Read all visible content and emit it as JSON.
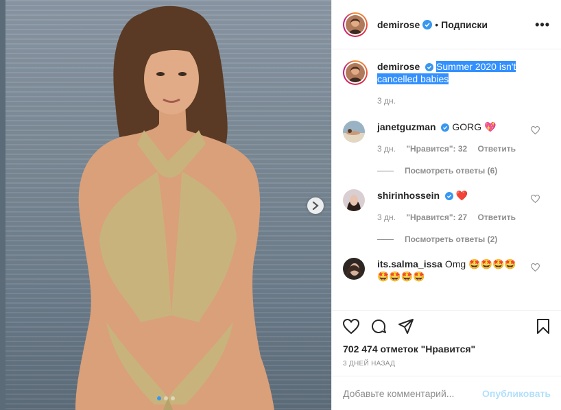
{
  "post": {
    "author": "demirose",
    "follow_separator": "•",
    "follow_label": "Подписки",
    "more_label": "•••",
    "caption": "Summer 2020 isn't cancelled babies",
    "caption_age": "3 дн.",
    "likes_text": "702 474 отметок \"Нравится\"",
    "posted_ago": "3 ДНЕЙ НАЗАД",
    "carousel": {
      "slides": 3,
      "active": 1
    }
  },
  "comments": [
    {
      "user": "janetguzman",
      "verified": true,
      "text": "GORG 💖",
      "age": "3 дн.",
      "likes": "\"Нравится\": 32",
      "reply_label": "Ответить",
      "replies": "Посмотреть ответы (6)"
    },
    {
      "user": "shirinhossein",
      "verified": true,
      "text": "❤️",
      "age": "3 дн.",
      "likes": "\"Нравится\": 27",
      "reply_label": "Ответить",
      "replies": "Посмотреть ответы (2)"
    },
    {
      "user": "its.salma_issa",
      "verified": false,
      "text": "Omg 🤩🤩🤩🤩🤩🤩🤩🤩"
    }
  ],
  "composer": {
    "placeholder": "Добавьте комментарий...",
    "publish_label": "Опубликовать"
  },
  "colors": {
    "accent": "#3897f0",
    "publish_disabled": "#b2dffc",
    "muted": "#8e8e8e",
    "selection": "#3390ff"
  }
}
